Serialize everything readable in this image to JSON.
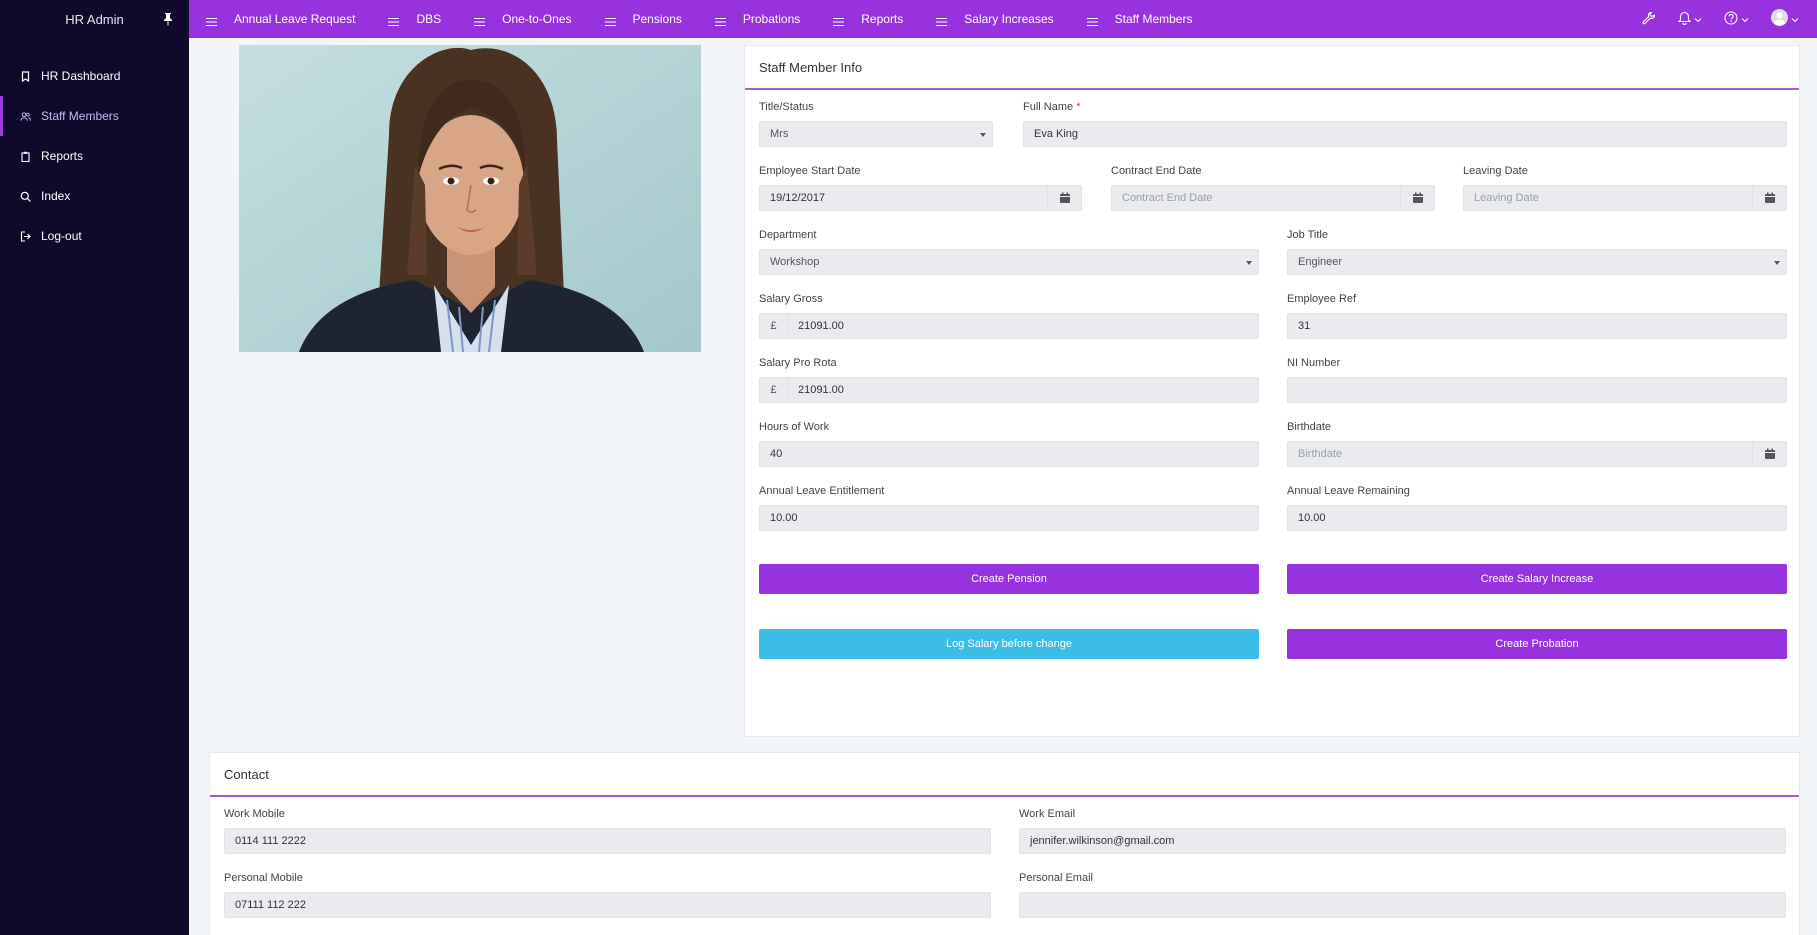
{
  "sidebar": {
    "title": "HR Admin",
    "items": [
      {
        "label": "HR Dashboard"
      },
      {
        "label": "Staff Members"
      },
      {
        "label": "Reports"
      },
      {
        "label": "Index"
      },
      {
        "label": "Log-out"
      }
    ]
  },
  "topnav": {
    "items": [
      {
        "label": "Annual Leave Request"
      },
      {
        "label": "DBS"
      },
      {
        "label": "One-to-Ones"
      },
      {
        "label": "Pensions"
      },
      {
        "label": "Probations"
      },
      {
        "label": "Reports"
      },
      {
        "label": "Salary Increases"
      },
      {
        "label": "Staff Members"
      }
    ]
  },
  "info": {
    "title": "Staff Member Info",
    "title_status": {
      "label": "Title/Status",
      "value": "Mrs"
    },
    "full_name": {
      "label": "Full Name",
      "required_mark": "*",
      "value": "Eva King"
    },
    "start_date": {
      "label": "Employee Start Date",
      "value": "19/12/2017"
    },
    "contract_end": {
      "label": "Contract End Date",
      "placeholder": "Contract End Date"
    },
    "leaving_date": {
      "label": "Leaving Date",
      "placeholder": "Leaving Date"
    },
    "department": {
      "label": "Department",
      "value": "Workshop"
    },
    "job_title": {
      "label": "Job Title",
      "value": "Engineer"
    },
    "salary_gross": {
      "label": "Salary Gross",
      "currency": "£",
      "value": "21091.00"
    },
    "employee_ref": {
      "label": "Employee Ref",
      "value": "31"
    },
    "salary_pro_rota": {
      "label": "Salary Pro Rota",
      "currency": "£",
      "value": "21091.00"
    },
    "ni_number": {
      "label": "NI Number",
      "value": ""
    },
    "hours": {
      "label": "Hours of Work",
      "value": "40"
    },
    "birthdate": {
      "label": "Birthdate",
      "placeholder": "Birthdate"
    },
    "al_entitlement": {
      "label": "Annual Leave Entitlement",
      "value": "10.00"
    },
    "al_remaining": {
      "label": "Annual Leave Remaining",
      "value": "10.00"
    },
    "buttons": {
      "create_pension": "Create Pension",
      "create_salary_increase": "Create Salary Increase",
      "log_salary": "Log Salary before change",
      "create_probation": "Create Probation"
    }
  },
  "contact": {
    "title": "Contact",
    "work_mobile": {
      "label": "Work Mobile",
      "value": "0114 111 2222"
    },
    "work_email": {
      "label": "Work Email",
      "value": "jennifer.wilkinson@gmail.com"
    },
    "personal_mobile": {
      "label": "Personal Mobile",
      "value": "07111 112 222"
    },
    "personal_email": {
      "label": "Personal Email",
      "value": ""
    }
  },
  "colors": {
    "sidebar_bg": "#0f0a2c",
    "accent": "#9633de",
    "cyan_button": "#3cbde8"
  }
}
